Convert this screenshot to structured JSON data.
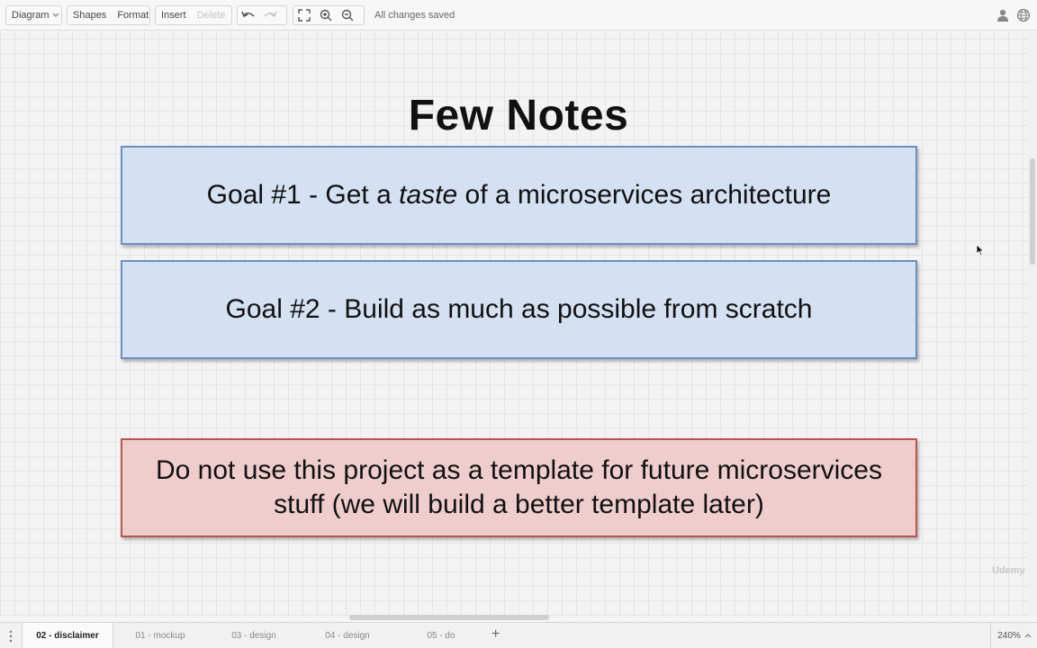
{
  "toolbar": {
    "diagram_label": "Diagram",
    "shapes_label": "Shapes",
    "format_label": "Format",
    "insert_label": "Insert",
    "delete_label": "Delete",
    "status": "All changes saved",
    "icons": [
      "chevron-down-icon",
      "undo-icon",
      "redo-icon",
      "fit-page-icon",
      "zoom-in-icon",
      "zoom-out-icon",
      "user-icon",
      "globe-icon"
    ]
  },
  "canvas": {
    "title": "Few Notes",
    "goal1": {
      "prefix": "Goal #1 - Get a ",
      "emphasis": "taste",
      "suffix": " of a microservices architecture"
    },
    "goal2": "Goal #2 - Build as much as possible from scratch",
    "warning_line1": "Do not use this project as a template for future microservices",
    "warning_line2": "stuff (we will build a better template later)"
  },
  "watermark": "Udemy",
  "tabs": [
    {
      "label": "02 - disclaimer",
      "active": true
    },
    {
      "label": "01 - mockup",
      "active": false
    },
    {
      "label": "03 - design",
      "active": false
    },
    {
      "label": "04 - design",
      "active": false
    },
    {
      "label": "05 - do",
      "active": false
    }
  ],
  "add_tab": "+",
  "zoom": "240%",
  "colors": {
    "blue_fill": "#d4e1f3",
    "blue_stroke": "#6c8ebf",
    "red_fill": "#f0cdcd",
    "red_stroke": "#b85450"
  }
}
